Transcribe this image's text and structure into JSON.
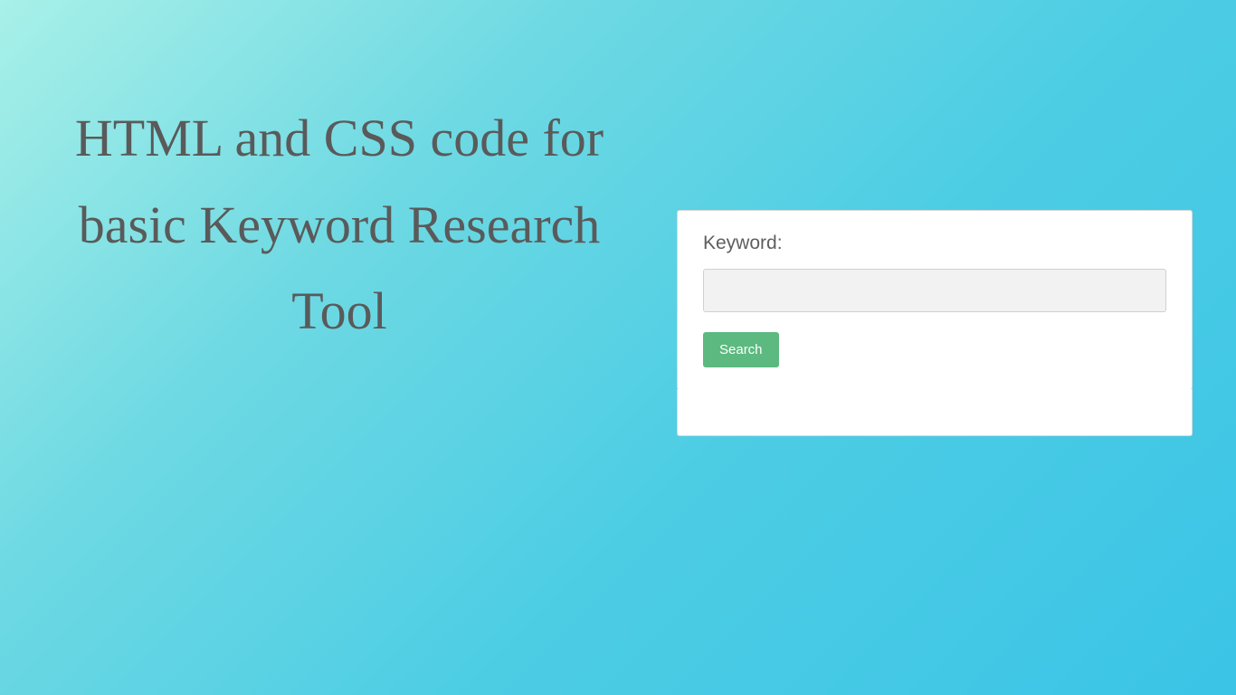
{
  "heading": "HTML and CSS code for basic Keyword Research Tool",
  "form": {
    "label": "Keyword:",
    "input_value": "",
    "button_label": "Search"
  }
}
